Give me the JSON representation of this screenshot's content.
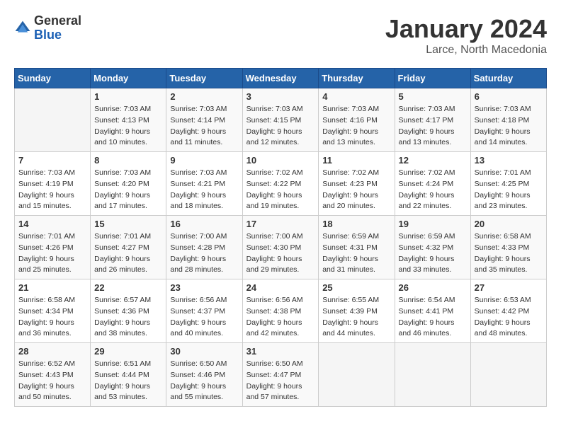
{
  "header": {
    "logo": {
      "general": "General",
      "blue": "Blue"
    },
    "title": "January 2024",
    "location": "Larce, North Macedonia"
  },
  "days_of_week": [
    "Sunday",
    "Monday",
    "Tuesday",
    "Wednesday",
    "Thursday",
    "Friday",
    "Saturday"
  ],
  "weeks": [
    [
      {
        "day": "",
        "sunrise": "",
        "sunset": "",
        "daylight": ""
      },
      {
        "day": "1",
        "sunrise": "Sunrise: 7:03 AM",
        "sunset": "Sunset: 4:13 PM",
        "daylight": "Daylight: 9 hours and 10 minutes."
      },
      {
        "day": "2",
        "sunrise": "Sunrise: 7:03 AM",
        "sunset": "Sunset: 4:14 PM",
        "daylight": "Daylight: 9 hours and 11 minutes."
      },
      {
        "day": "3",
        "sunrise": "Sunrise: 7:03 AM",
        "sunset": "Sunset: 4:15 PM",
        "daylight": "Daylight: 9 hours and 12 minutes."
      },
      {
        "day": "4",
        "sunrise": "Sunrise: 7:03 AM",
        "sunset": "Sunset: 4:16 PM",
        "daylight": "Daylight: 9 hours and 13 minutes."
      },
      {
        "day": "5",
        "sunrise": "Sunrise: 7:03 AM",
        "sunset": "Sunset: 4:17 PM",
        "daylight": "Daylight: 9 hours and 13 minutes."
      },
      {
        "day": "6",
        "sunrise": "Sunrise: 7:03 AM",
        "sunset": "Sunset: 4:18 PM",
        "daylight": "Daylight: 9 hours and 14 minutes."
      }
    ],
    [
      {
        "day": "7",
        "sunrise": "Sunrise: 7:03 AM",
        "sunset": "Sunset: 4:19 PM",
        "daylight": "Daylight: 9 hours and 15 minutes."
      },
      {
        "day": "8",
        "sunrise": "Sunrise: 7:03 AM",
        "sunset": "Sunset: 4:20 PM",
        "daylight": "Daylight: 9 hours and 17 minutes."
      },
      {
        "day": "9",
        "sunrise": "Sunrise: 7:03 AM",
        "sunset": "Sunset: 4:21 PM",
        "daylight": "Daylight: 9 hours and 18 minutes."
      },
      {
        "day": "10",
        "sunrise": "Sunrise: 7:02 AM",
        "sunset": "Sunset: 4:22 PM",
        "daylight": "Daylight: 9 hours and 19 minutes."
      },
      {
        "day": "11",
        "sunrise": "Sunrise: 7:02 AM",
        "sunset": "Sunset: 4:23 PM",
        "daylight": "Daylight: 9 hours and 20 minutes."
      },
      {
        "day": "12",
        "sunrise": "Sunrise: 7:02 AM",
        "sunset": "Sunset: 4:24 PM",
        "daylight": "Daylight: 9 hours and 22 minutes."
      },
      {
        "day": "13",
        "sunrise": "Sunrise: 7:01 AM",
        "sunset": "Sunset: 4:25 PM",
        "daylight": "Daylight: 9 hours and 23 minutes."
      }
    ],
    [
      {
        "day": "14",
        "sunrise": "Sunrise: 7:01 AM",
        "sunset": "Sunset: 4:26 PM",
        "daylight": "Daylight: 9 hours and 25 minutes."
      },
      {
        "day": "15",
        "sunrise": "Sunrise: 7:01 AM",
        "sunset": "Sunset: 4:27 PM",
        "daylight": "Daylight: 9 hours and 26 minutes."
      },
      {
        "day": "16",
        "sunrise": "Sunrise: 7:00 AM",
        "sunset": "Sunset: 4:28 PM",
        "daylight": "Daylight: 9 hours and 28 minutes."
      },
      {
        "day": "17",
        "sunrise": "Sunrise: 7:00 AM",
        "sunset": "Sunset: 4:30 PM",
        "daylight": "Daylight: 9 hours and 29 minutes."
      },
      {
        "day": "18",
        "sunrise": "Sunrise: 6:59 AM",
        "sunset": "Sunset: 4:31 PM",
        "daylight": "Daylight: 9 hours and 31 minutes."
      },
      {
        "day": "19",
        "sunrise": "Sunrise: 6:59 AM",
        "sunset": "Sunset: 4:32 PM",
        "daylight": "Daylight: 9 hours and 33 minutes."
      },
      {
        "day": "20",
        "sunrise": "Sunrise: 6:58 AM",
        "sunset": "Sunset: 4:33 PM",
        "daylight": "Daylight: 9 hours and 35 minutes."
      }
    ],
    [
      {
        "day": "21",
        "sunrise": "Sunrise: 6:58 AM",
        "sunset": "Sunset: 4:34 PM",
        "daylight": "Daylight: 9 hours and 36 minutes."
      },
      {
        "day": "22",
        "sunrise": "Sunrise: 6:57 AM",
        "sunset": "Sunset: 4:36 PM",
        "daylight": "Daylight: 9 hours and 38 minutes."
      },
      {
        "day": "23",
        "sunrise": "Sunrise: 6:56 AM",
        "sunset": "Sunset: 4:37 PM",
        "daylight": "Daylight: 9 hours and 40 minutes."
      },
      {
        "day": "24",
        "sunrise": "Sunrise: 6:56 AM",
        "sunset": "Sunset: 4:38 PM",
        "daylight": "Daylight: 9 hours and 42 minutes."
      },
      {
        "day": "25",
        "sunrise": "Sunrise: 6:55 AM",
        "sunset": "Sunset: 4:39 PM",
        "daylight": "Daylight: 9 hours and 44 minutes."
      },
      {
        "day": "26",
        "sunrise": "Sunrise: 6:54 AM",
        "sunset": "Sunset: 4:41 PM",
        "daylight": "Daylight: 9 hours and 46 minutes."
      },
      {
        "day": "27",
        "sunrise": "Sunrise: 6:53 AM",
        "sunset": "Sunset: 4:42 PM",
        "daylight": "Daylight: 9 hours and 48 minutes."
      }
    ],
    [
      {
        "day": "28",
        "sunrise": "Sunrise: 6:52 AM",
        "sunset": "Sunset: 4:43 PM",
        "daylight": "Daylight: 9 hours and 50 minutes."
      },
      {
        "day": "29",
        "sunrise": "Sunrise: 6:51 AM",
        "sunset": "Sunset: 4:44 PM",
        "daylight": "Daylight: 9 hours and 53 minutes."
      },
      {
        "day": "30",
        "sunrise": "Sunrise: 6:50 AM",
        "sunset": "Sunset: 4:46 PM",
        "daylight": "Daylight: 9 hours and 55 minutes."
      },
      {
        "day": "31",
        "sunrise": "Sunrise: 6:50 AM",
        "sunset": "Sunset: 4:47 PM",
        "daylight": "Daylight: 9 hours and 57 minutes."
      },
      {
        "day": "",
        "sunrise": "",
        "sunset": "",
        "daylight": ""
      },
      {
        "day": "",
        "sunrise": "",
        "sunset": "",
        "daylight": ""
      },
      {
        "day": "",
        "sunrise": "",
        "sunset": "",
        "daylight": ""
      }
    ]
  ]
}
